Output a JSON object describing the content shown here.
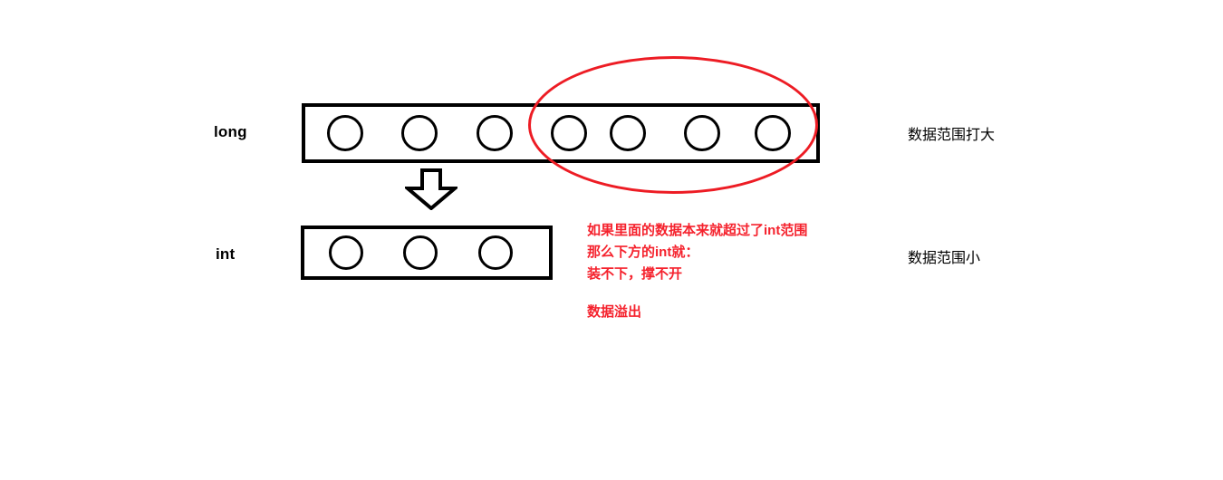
{
  "diagram": {
    "title_text_present": false,
    "types": {
      "long": {
        "label": "long",
        "slot_count": 7,
        "range_note": "数据范围打大"
      },
      "int": {
        "label": "int",
        "slot_count": 3,
        "range_note": "数据范围小"
      }
    },
    "arrow": {
      "name": "down-block-arrow",
      "direction": "down"
    },
    "highlight": {
      "name": "overflow-highlight-ellipse",
      "color": "#ED1C24",
      "covers_slots": 4
    },
    "notes": {
      "color": "#F5222D",
      "lines": [
        "如果里面的数据本来就超过了int范围",
        "那么下方的int就：",
        "装不下，撑不开"
      ],
      "conclusion": "数据溢出"
    },
    "colors": {
      "stroke": "#000000",
      "accent_red": "#ED1C24",
      "text_red": "#F5222D",
      "background": "#FFFFFF"
    }
  }
}
